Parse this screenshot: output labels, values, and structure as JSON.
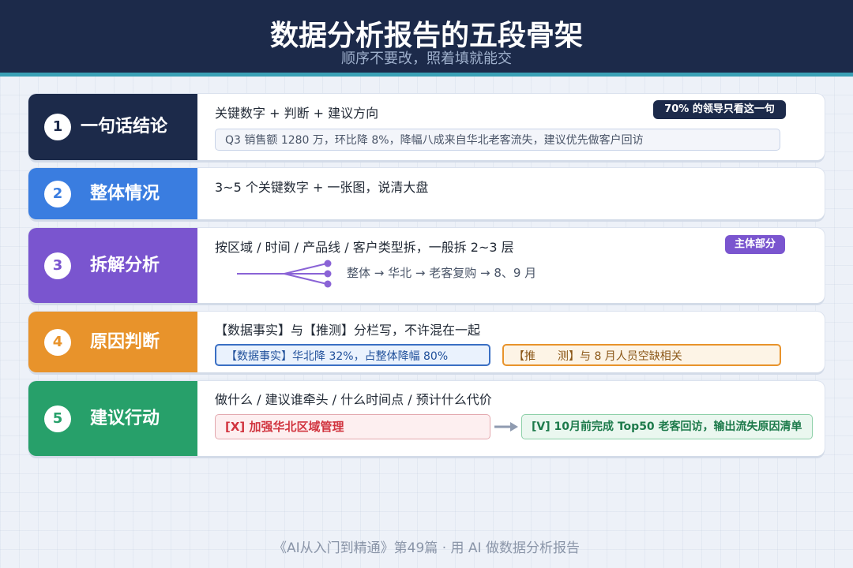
{
  "header": {
    "title": "数据分析报告的五段骨架",
    "subtitle": "顺序不要改，照着填就能交"
  },
  "sections": [
    {
      "number": "1",
      "label": "一句话结论",
      "color": "#1c2a4a",
      "formula": "关键数字 + 判断 + 建议方向",
      "badge": "70% 的领导只看这一句",
      "example": "Q3 销售额 1280 万，环比降 8%，降幅八成来自华北老客流失，建议优先做客户回访"
    },
    {
      "number": "2",
      "label": "整体情况",
      "color": "#3a7de0",
      "formula": "3~5 个关键数字 + 一张图，说清大盘"
    },
    {
      "number": "3",
      "label": "拆解分析",
      "color": "#7a55cf",
      "formula": "按区域 / 时间 / 产品线 / 客户类型拆，一般拆 2~3 层",
      "badge": "主体部分",
      "drill_path": "整体 → 华北 → 老客复购 → 8、9 月"
    },
    {
      "number": "4",
      "label": "原因判断",
      "color": "#e8932b",
      "formula": "【数据事实】与【推测】分栏写，不许混在一起",
      "fact": "【数据事实】华北降 32%，占整体降幅 80%",
      "guess": "【推　　测】与 8 月人员空缺相关"
    },
    {
      "number": "5",
      "label": "建议行动",
      "color": "#27a06a",
      "formula": "做什么 / 建议谁牵头 / 什么时间点 / 预计什么代价",
      "bad": "[X] 加强华北区域管理",
      "good": "[V] 10月前完成 Top50 老客回访，输出流失原因清单"
    }
  ],
  "footer": "《AI从入门到精通》第49篇 · 用 AI 做数据分析报告"
}
